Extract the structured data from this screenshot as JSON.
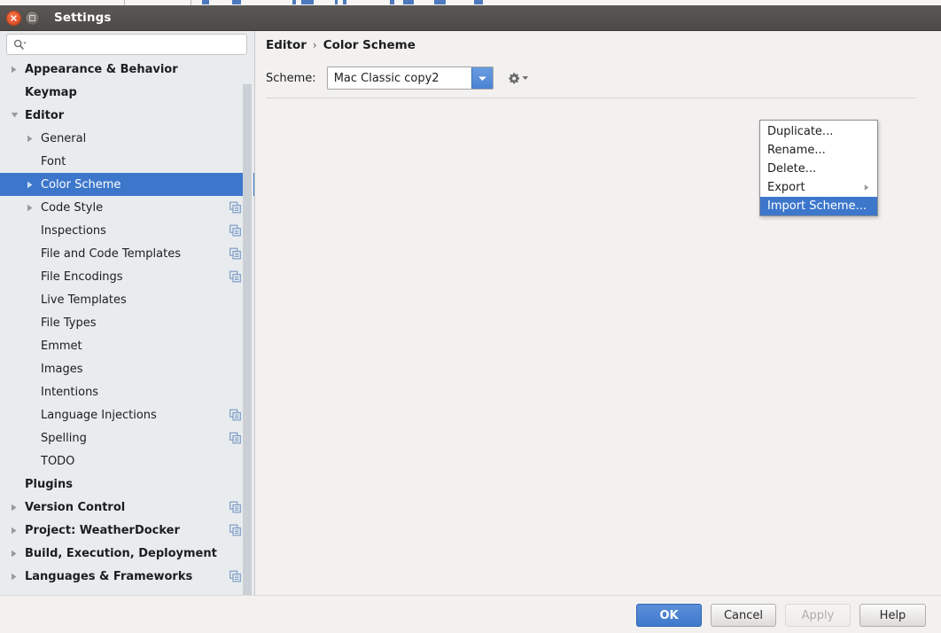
{
  "window": {
    "title": "Settings",
    "close_icon": "close-icon",
    "maximize_icon": "maximize-icon"
  },
  "sidebar": {
    "search": {
      "placeholder": "",
      "value": "",
      "icon": "search-icon"
    },
    "items": [
      {
        "label": "Appearance & Behavior",
        "indent": 0,
        "bold": true,
        "twisty": "collapsed",
        "copy": false,
        "selected": false
      },
      {
        "label": "Keymap",
        "indent": 0,
        "bold": true,
        "twisty": "none",
        "copy": false,
        "selected": false
      },
      {
        "label": "Editor",
        "indent": 0,
        "bold": true,
        "twisty": "expanded",
        "copy": false,
        "selected": false
      },
      {
        "label": "General",
        "indent": 1,
        "bold": false,
        "twisty": "collapsed",
        "copy": false,
        "selected": false
      },
      {
        "label": "Font",
        "indent": 1,
        "bold": false,
        "twisty": "none",
        "copy": false,
        "selected": false
      },
      {
        "label": "Color Scheme",
        "indent": 1,
        "bold": false,
        "twisty": "collapsed",
        "copy": false,
        "selected": true
      },
      {
        "label": "Code Style",
        "indent": 1,
        "bold": false,
        "twisty": "collapsed",
        "copy": true,
        "selected": false
      },
      {
        "label": "Inspections",
        "indent": 1,
        "bold": false,
        "twisty": "none",
        "copy": true,
        "selected": false
      },
      {
        "label": "File and Code Templates",
        "indent": 1,
        "bold": false,
        "twisty": "none",
        "copy": true,
        "selected": false
      },
      {
        "label": "File Encodings",
        "indent": 1,
        "bold": false,
        "twisty": "none",
        "copy": true,
        "selected": false
      },
      {
        "label": "Live Templates",
        "indent": 1,
        "bold": false,
        "twisty": "none",
        "copy": false,
        "selected": false
      },
      {
        "label": "File Types",
        "indent": 1,
        "bold": false,
        "twisty": "none",
        "copy": false,
        "selected": false
      },
      {
        "label": "Emmet",
        "indent": 1,
        "bold": false,
        "twisty": "none",
        "copy": false,
        "selected": false
      },
      {
        "label": "Images",
        "indent": 1,
        "bold": false,
        "twisty": "none",
        "copy": false,
        "selected": false
      },
      {
        "label": "Intentions",
        "indent": 1,
        "bold": false,
        "twisty": "none",
        "copy": false,
        "selected": false
      },
      {
        "label": "Language Injections",
        "indent": 1,
        "bold": false,
        "twisty": "none",
        "copy": true,
        "selected": false
      },
      {
        "label": "Spelling",
        "indent": 1,
        "bold": false,
        "twisty": "none",
        "copy": true,
        "selected": false
      },
      {
        "label": "TODO",
        "indent": 1,
        "bold": false,
        "twisty": "none",
        "copy": false,
        "selected": false
      },
      {
        "label": "Plugins",
        "indent": 0,
        "bold": true,
        "twisty": "none",
        "copy": false,
        "selected": false
      },
      {
        "label": "Version Control",
        "indent": 0,
        "bold": true,
        "twisty": "collapsed",
        "copy": true,
        "selected": false
      },
      {
        "label": "Project: WeatherDocker",
        "indent": 0,
        "bold": true,
        "twisty": "collapsed",
        "copy": true,
        "selected": false
      },
      {
        "label": "Build, Execution, Deployment",
        "indent": 0,
        "bold": true,
        "twisty": "collapsed",
        "copy": false,
        "selected": false
      },
      {
        "label": "Languages & Frameworks",
        "indent": 0,
        "bold": true,
        "twisty": "collapsed",
        "copy": true,
        "selected": false
      }
    ]
  },
  "content": {
    "breadcrumb": {
      "root": "Editor",
      "separator": "›",
      "current": "Color Scheme"
    },
    "scheme": {
      "label": "Scheme:",
      "value": "Mac Classic copy2",
      "dropdown_icon": "chevron-down-icon",
      "gear_icon": "gear-icon"
    }
  },
  "menu": {
    "items": [
      {
        "label": "Duplicate...",
        "highlighted": false,
        "submenu": false
      },
      {
        "label": "Rename...",
        "highlighted": false,
        "submenu": false
      },
      {
        "label": "Delete...",
        "highlighted": false,
        "submenu": false
      },
      {
        "label": "Export",
        "highlighted": false,
        "submenu": true
      },
      {
        "label": "Import Scheme...",
        "highlighted": true,
        "submenu": false
      }
    ]
  },
  "footer": {
    "ok": "OK",
    "cancel": "Cancel",
    "apply": "Apply",
    "help": "Help"
  },
  "colors": {
    "selection_blue": "#3d77cc",
    "titlebar": "#55514e",
    "sidebar_bg": "#e8ecef",
    "content_bg": "#f2f1f0",
    "close_button": "#e2562c"
  }
}
